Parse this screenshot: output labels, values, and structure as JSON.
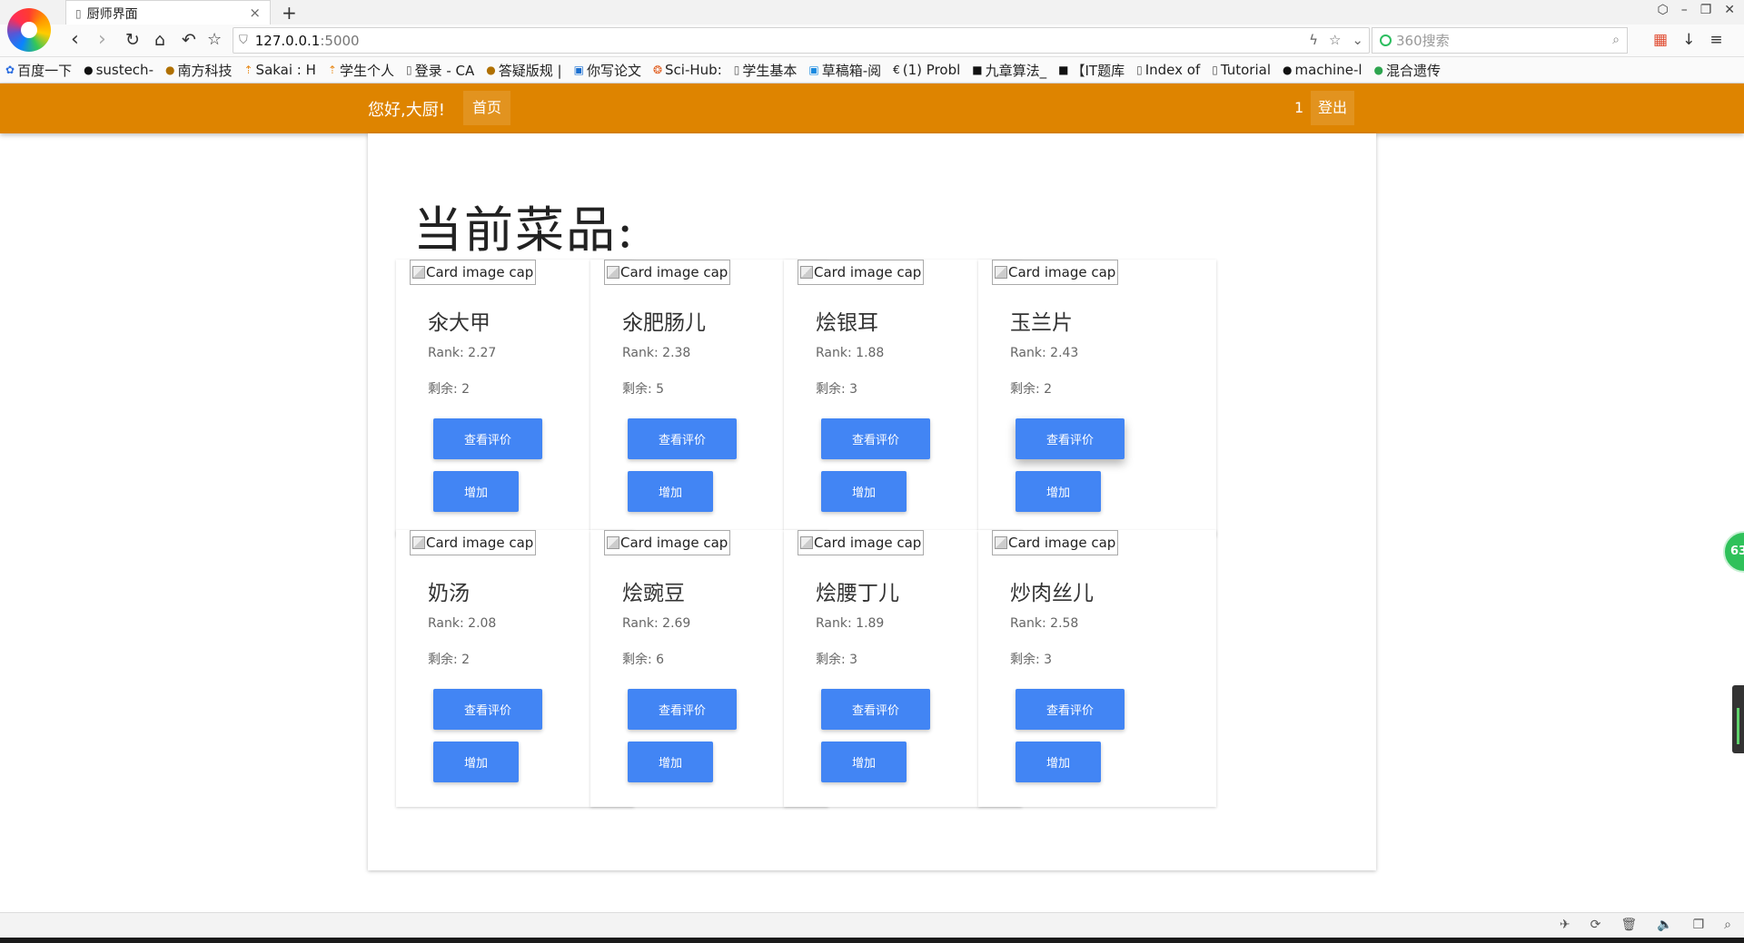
{
  "browser": {
    "tab_title": "厨师界面",
    "tab_close": "×",
    "new_tab": "+",
    "window_controls": [
      "⬡",
      "–",
      "❐",
      "✕"
    ],
    "url_host": "127.0.0.1",
    "url_port": ":5000",
    "search_placeholder": "360搜索",
    "bookmarks": [
      "百度一下",
      "sustech-",
      "南方科技",
      "Sakai : H",
      "学生个人",
      "登录 - CA",
      "答疑版规 |",
      "你写论文",
      "Sci-Hub:",
      "学生基本",
      "草稿箱-阅",
      "(1) Probl",
      "九章算法_",
      "【IT题库",
      "Index of",
      "Tutorial",
      "machine-l",
      "混合遗传"
    ]
  },
  "nav": {
    "greeting": "您好,大厨!",
    "home": "首页",
    "count": "1",
    "logout": "登出"
  },
  "page": {
    "title": "当前菜品:"
  },
  "labels": {
    "image_alt": "Card image cap",
    "rank_prefix": "Rank: ",
    "remain_prefix": "剩余: ",
    "review_button": "查看评价",
    "add_button": "增加"
  },
  "dishes": [
    {
      "name": "氽大甲",
      "rank": "2.27",
      "remain": "2"
    },
    {
      "name": "氽肥肠儿",
      "rank": "2.38",
      "remain": "5"
    },
    {
      "name": "烩银耳",
      "rank": "1.88",
      "remain": "3"
    },
    {
      "name": "玉兰片",
      "rank": "2.43",
      "remain": "2"
    },
    {
      "name": "奶汤",
      "rank": "2.08",
      "remain": "2"
    },
    {
      "name": "烩豌豆",
      "rank": "2.69",
      "remain": "6"
    },
    {
      "name": "烩腰丁儿",
      "rank": "1.89",
      "remain": "3"
    },
    {
      "name": "炒肉丝儿",
      "rank": "2.58",
      "remain": "3"
    }
  ],
  "side": {
    "badge": "63"
  },
  "colors": {
    "nav_orange": "#de8400",
    "button_blue": "#4285f4"
  }
}
